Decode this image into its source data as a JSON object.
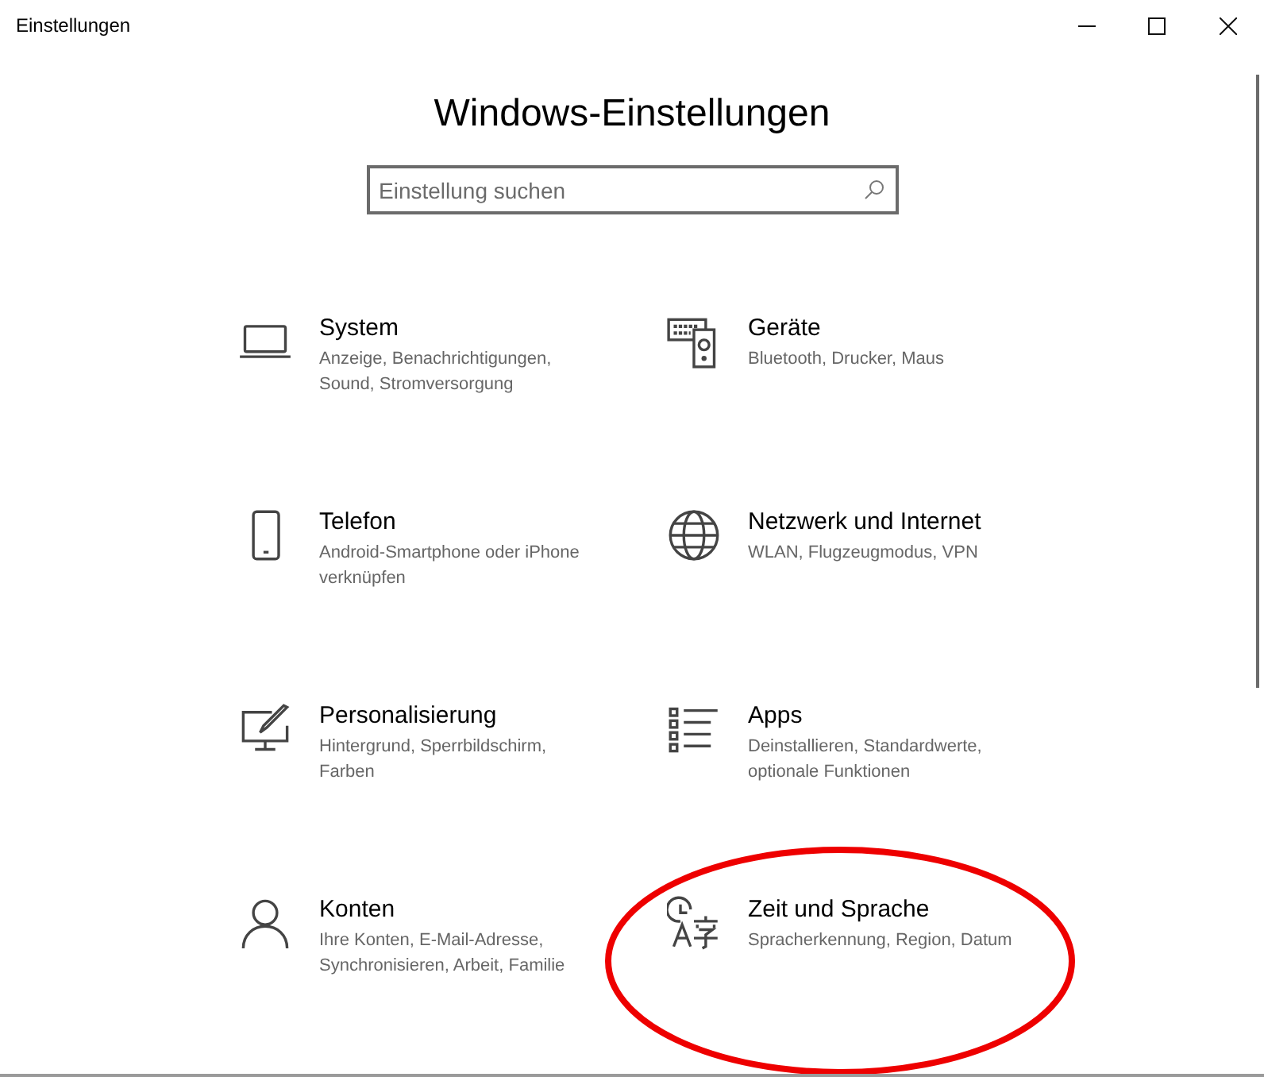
{
  "window": {
    "title": "Einstellungen"
  },
  "heading": "Windows-Einstellungen",
  "search": {
    "placeholder": "Einstellung suchen"
  },
  "categories": [
    {
      "title": "System",
      "description": "Anzeige, Benachrichtigungen, Sound, Stromversorgung"
    },
    {
      "title": "Geräte",
      "description": "Bluetooth, Drucker, Maus"
    },
    {
      "title": "Telefon",
      "description": "Android-Smartphone oder iPhone verknüpfen"
    },
    {
      "title": "Netzwerk und Internet",
      "description": "WLAN, Flugzeugmodus, VPN"
    },
    {
      "title": "Personalisierung",
      "description": "Hintergrund, Sperrbildschirm, Farben"
    },
    {
      "title": "Apps",
      "description": "Deinstallieren, Standardwerte, optionale Funktionen"
    },
    {
      "title": "Konten",
      "description": "Ihre Konten, E-Mail-Adresse, Synchronisieren, Arbeit, Familie"
    },
    {
      "title": "Zeit und Sprache",
      "description": "Spracherkennung, Region, Datum"
    }
  ]
}
